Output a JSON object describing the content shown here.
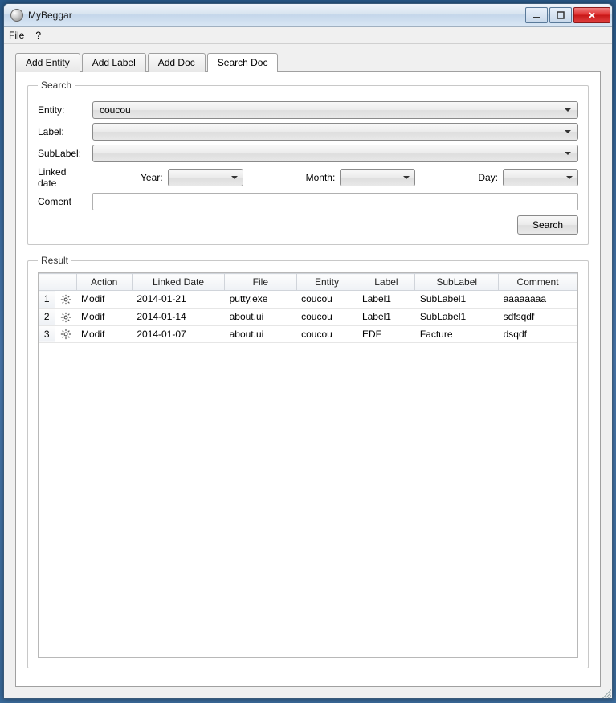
{
  "window": {
    "title": "MyBeggar"
  },
  "menubar": {
    "file": "File",
    "help": "?"
  },
  "tabs": [
    {
      "label": "Add Entity",
      "active": false
    },
    {
      "label": "Add Label",
      "active": false
    },
    {
      "label": "Add Doc",
      "active": false
    },
    {
      "label": "Search Doc",
      "active": true
    }
  ],
  "search": {
    "legend": "Search",
    "entity_label": "Entity:",
    "entity_value": "coucou",
    "label_label": "Label:",
    "label_value": "",
    "sublabel_label": "SubLabel:",
    "sublabel_value": "",
    "linked_date_label": "Linked date",
    "year_label": "Year:",
    "year_value": "",
    "month_label": "Month:",
    "month_value": "",
    "day_label": "Day:",
    "day_value": "",
    "coment_label": "Coment",
    "coment_value": "",
    "search_button": "Search"
  },
  "result": {
    "legend": "Result",
    "columns": {
      "rownum": "",
      "icon": "",
      "action": "Action",
      "linked_date": "Linked Date",
      "file": "File",
      "entity": "Entity",
      "label": "Label",
      "sublabel": "SubLabel",
      "comment": "Comment"
    },
    "rows": [
      {
        "n": "1",
        "action": "Modif",
        "linked_date": "2014-01-21",
        "file": "putty.exe",
        "entity": "coucou",
        "label": "Label1",
        "sublabel": "SubLabel1",
        "comment": "aaaaaaaa"
      },
      {
        "n": "2",
        "action": "Modif",
        "linked_date": "2014-01-14",
        "file": "about.ui",
        "entity": "coucou",
        "label": "Label1",
        "sublabel": "SubLabel1",
        "comment": "sdfsqdf"
      },
      {
        "n": "3",
        "action": "Modif",
        "linked_date": "2014-01-07",
        "file": "about.ui",
        "entity": "coucou",
        "label": "EDF",
        "sublabel": "Facture",
        "comment": "dsqdf"
      }
    ]
  }
}
